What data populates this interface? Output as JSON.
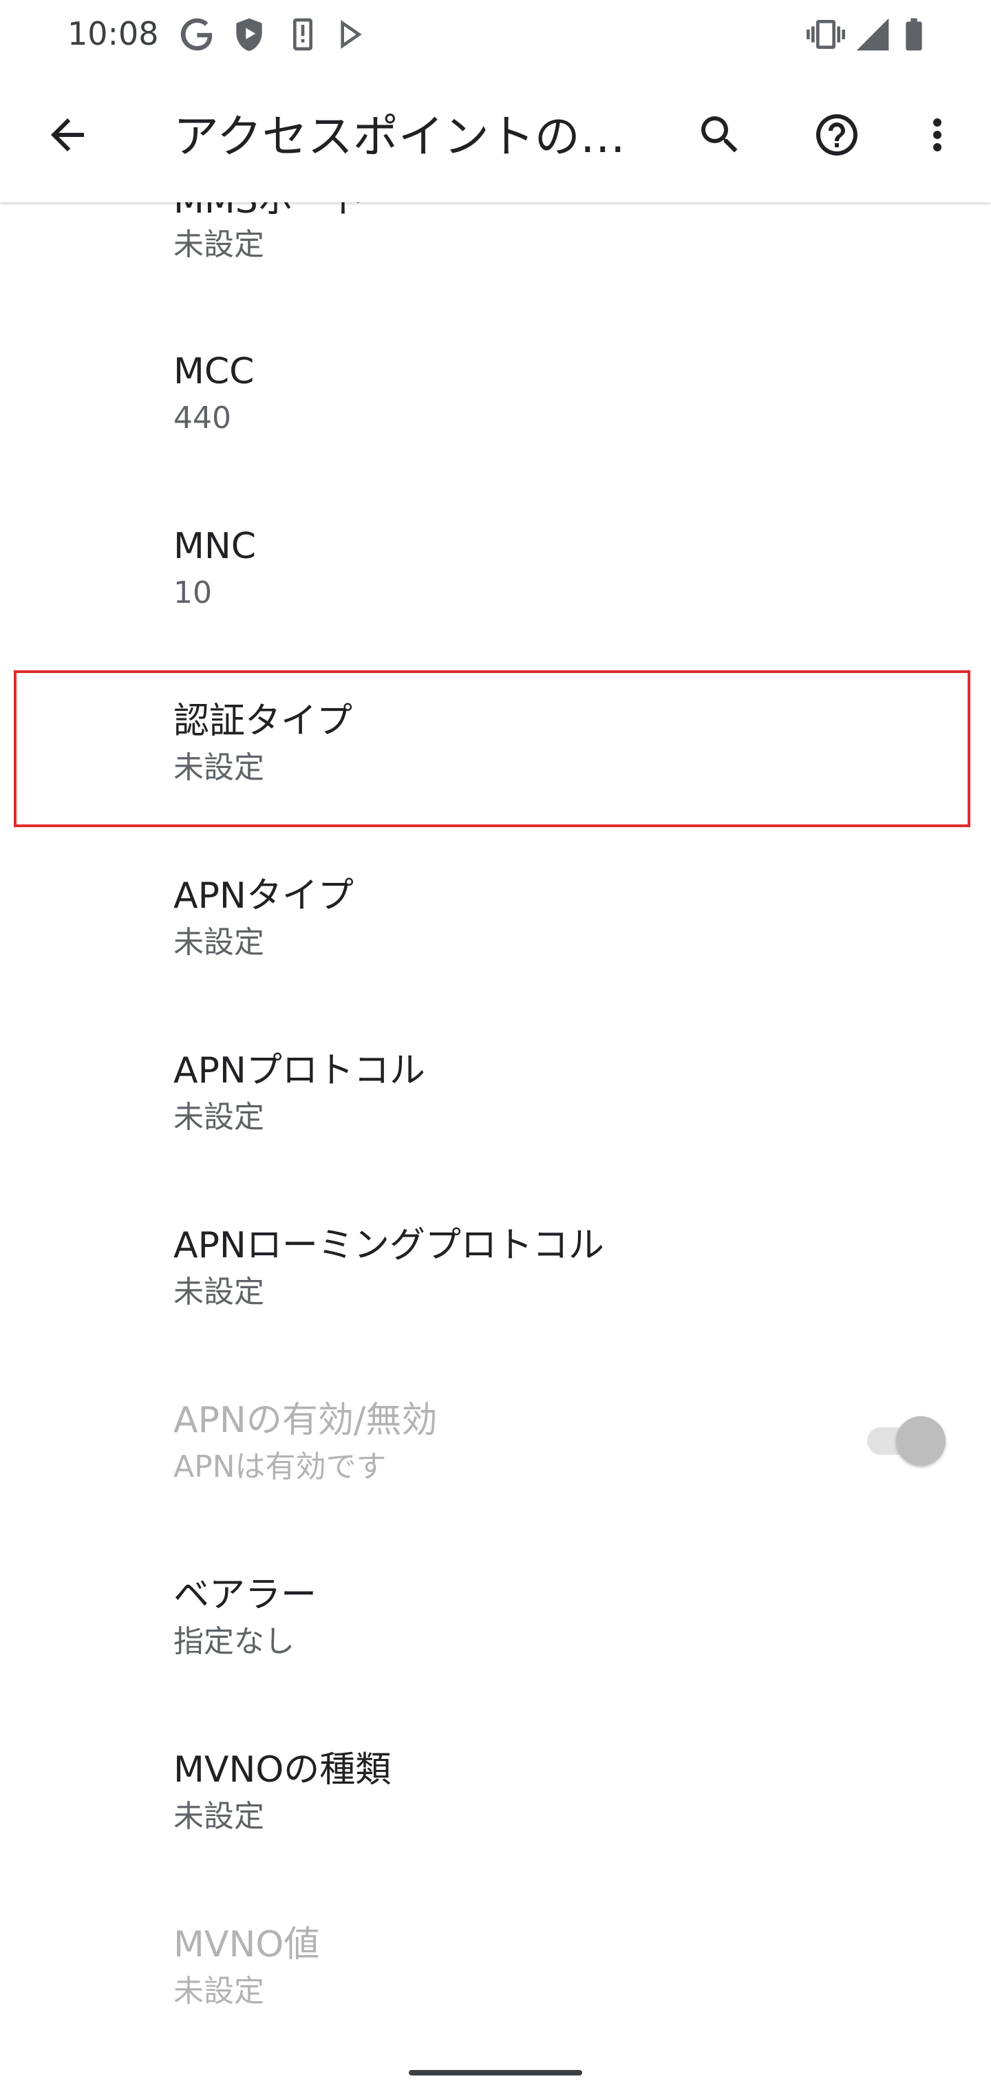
{
  "status_bar": {
    "time": "10:08",
    "left_icons": [
      "google-g-icon",
      "shield-icon",
      "device-info-icon",
      "play-store-icon"
    ],
    "right_icons": [
      "vibrate-icon",
      "signal-icon",
      "battery-icon"
    ]
  },
  "app_bar": {
    "title": "アクセスポイントの…",
    "back_icon": "arrow-back-icon",
    "search_icon": "search-icon",
    "help_icon": "help-icon",
    "more_icon": "more-vert-icon"
  },
  "preferences": [
    {
      "title": "MMSポート",
      "summary": "未設定",
      "enabled": true,
      "partially_visible": true
    },
    {
      "title": "MCC",
      "summary": "440",
      "enabled": true
    },
    {
      "title": "MNC",
      "summary": "10",
      "enabled": true
    },
    {
      "title": "認証タイプ",
      "summary": "未設定",
      "enabled": true,
      "highlighted": true
    },
    {
      "title": "APNタイプ",
      "summary": "未設定",
      "enabled": true
    },
    {
      "title": "APNプロトコル",
      "summary": "未設定",
      "enabled": true
    },
    {
      "title": "APNローミングプロトコル",
      "summary": "未設定",
      "enabled": true
    },
    {
      "title": "APNの有効/無効",
      "summary": "APNは有効です",
      "enabled": false,
      "switch_on": true
    },
    {
      "title": "ベアラー",
      "summary": "指定なし",
      "enabled": true
    },
    {
      "title": "MVNOの種類",
      "summary": "未設定",
      "enabled": true
    },
    {
      "title": "MVNO値",
      "summary": "未設定",
      "enabled": false
    }
  ],
  "colors": {
    "highlight_border": "#e02b2b",
    "title_text": "#202124",
    "summary_text": "#5f6368",
    "disabled_text": "#b3b3b3"
  }
}
